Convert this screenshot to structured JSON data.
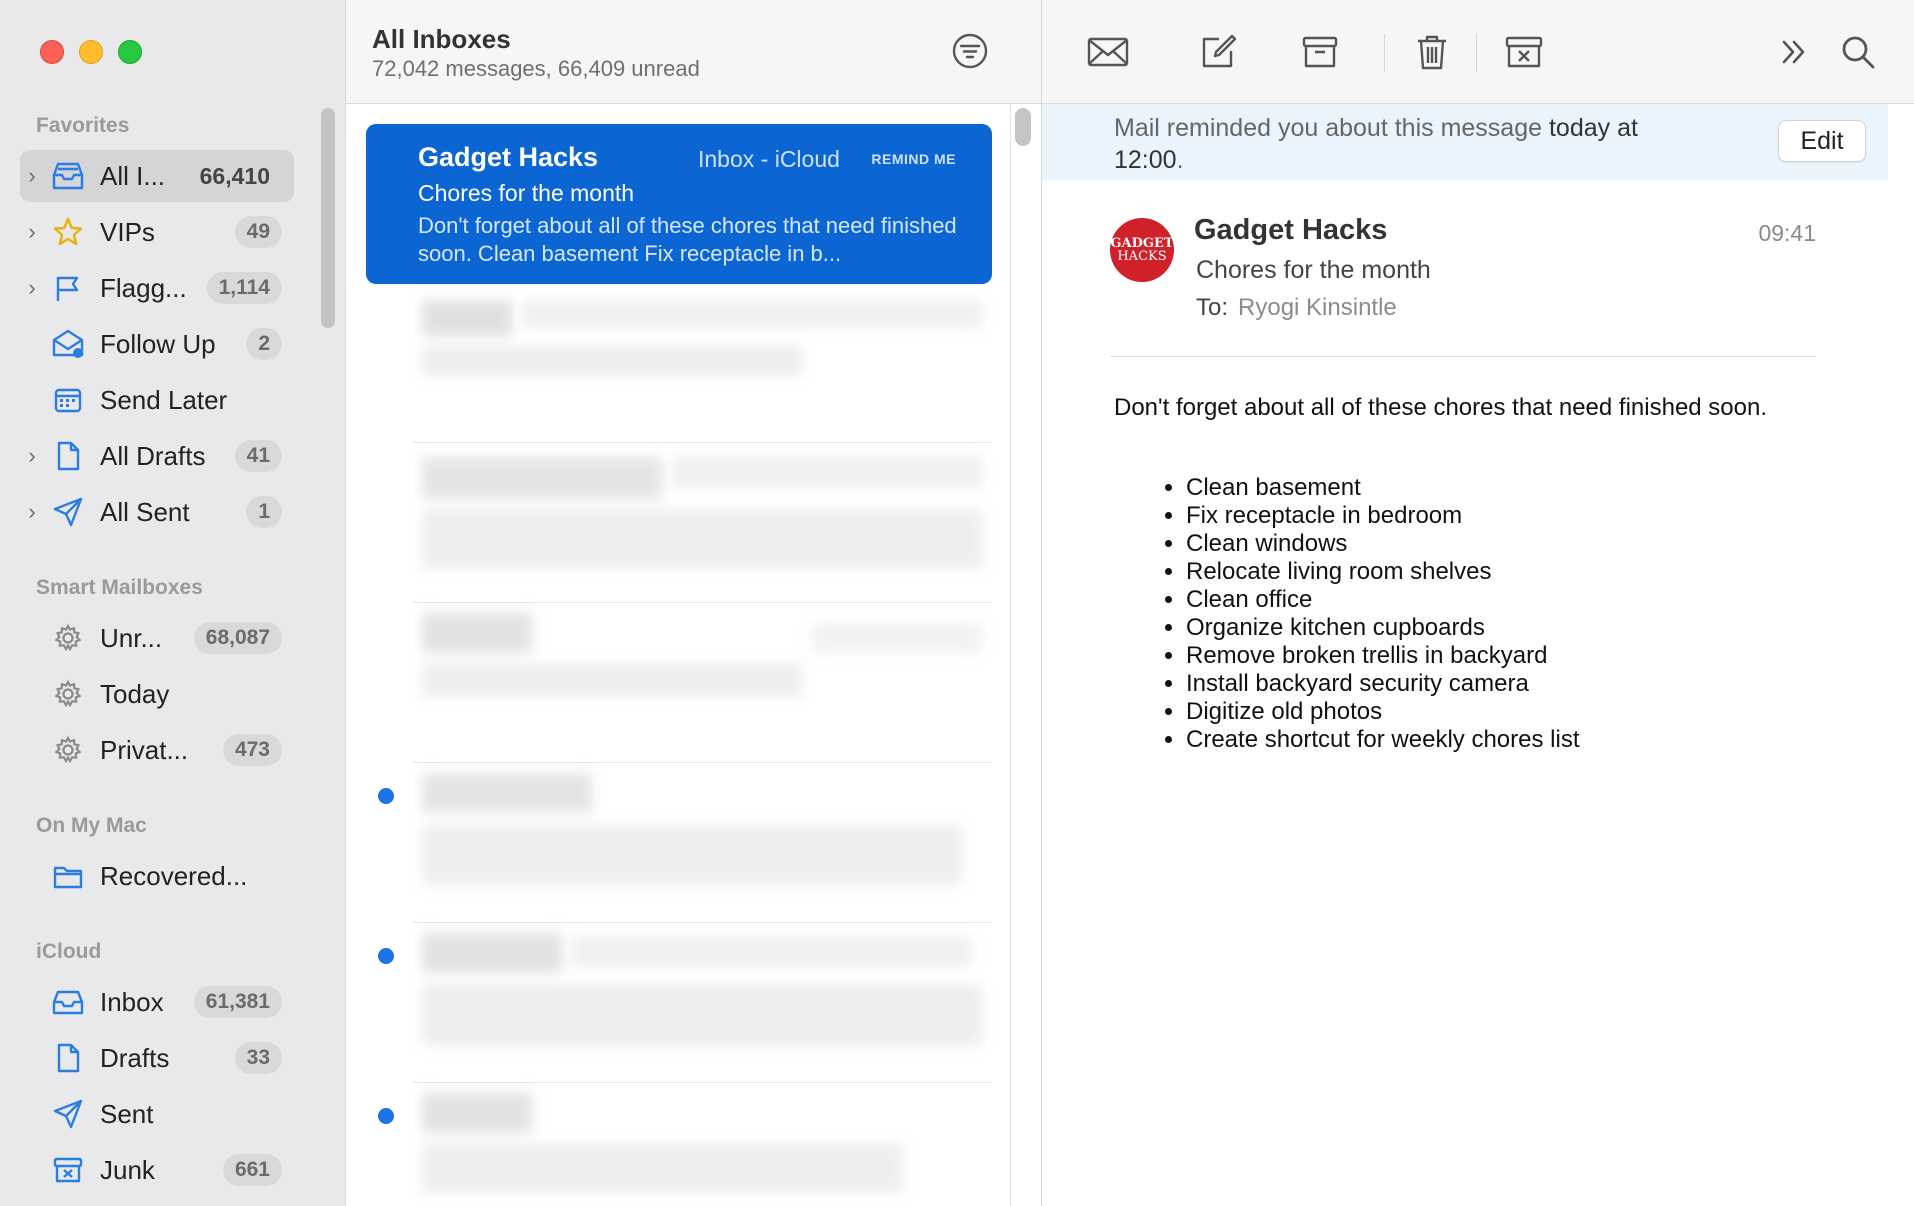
{
  "sidebar": {
    "favorites_title": "Favorites",
    "smart_title": "Smart Mailboxes",
    "onmac_title": "On My Mac",
    "icloud_title": "iCloud",
    "favorites": [
      {
        "label": "All I...",
        "badge": "66,410",
        "icon": "inbox-stack-icon"
      },
      {
        "label": "VIPs",
        "badge": "49",
        "icon": "star-icon"
      },
      {
        "label": "Flagg...",
        "badge": "1,114",
        "icon": "flag-icon"
      },
      {
        "label": "Follow Up",
        "badge": "2",
        "icon": "follow-up-envelope-icon"
      },
      {
        "label": "Send Later",
        "badge": "",
        "icon": "calendar-icon"
      },
      {
        "label": "All Drafts",
        "badge": "41",
        "icon": "document-icon"
      },
      {
        "label": "All Sent",
        "badge": "1",
        "icon": "paper-plane-icon"
      }
    ],
    "smart": [
      {
        "label": "Unr...",
        "badge": "68,087",
        "icon": "gear-icon"
      },
      {
        "label": "Today",
        "badge": "",
        "icon": "gear-icon"
      },
      {
        "label": "Privat...",
        "badge": "473",
        "icon": "gear-icon"
      }
    ],
    "onmac": [
      {
        "label": "Recovered...",
        "badge": "",
        "icon": "folder-icon"
      }
    ],
    "icloud": [
      {
        "label": "Inbox",
        "badge": "61,381",
        "icon": "inbox-tray-icon"
      },
      {
        "label": "Drafts",
        "badge": "33",
        "icon": "document-icon"
      },
      {
        "label": "Sent",
        "badge": "",
        "icon": "paper-plane-icon"
      },
      {
        "label": "Junk",
        "badge": "661",
        "icon": "junk-box-icon"
      }
    ]
  },
  "list": {
    "title": "All Inboxes",
    "subtitle": "72,042 messages, 66,409 unread",
    "selected": {
      "from": "Gadget Hacks",
      "mailbox": "Inbox - iCloud",
      "remind": "REMIND ME",
      "subject": "Chores for the month",
      "preview": "Don't forget about all of these chores that need finished soon. Clean basement Fix receptacle in b..."
    }
  },
  "reader": {
    "banner_prefix": "Mail reminded you about this message",
    "banner_emph": "today at 12:00",
    "banner_suffix": ".",
    "edit_label": "Edit",
    "avatar_line1": "GADGET",
    "avatar_line2": "HACKS",
    "sender": "Gadget Hacks",
    "time": "09:41",
    "subject": "Chores for the month",
    "to_label": "To:",
    "to_name": "Ryogi Kinsintle",
    "intro": "Don't forget about all of these chores that need finished soon.",
    "chores": [
      "Clean basement",
      "Fix receptacle in bedroom",
      "Clean windows",
      "Relocate living room shelves",
      "Clean office",
      "Organize kitchen cupboards",
      "Remove broken trellis in backyard",
      "Install backyard security camera",
      "Digitize old photos",
      "Create shortcut for weekly chores list"
    ]
  },
  "colors": {
    "accent": "#0b66d4",
    "sidebar_bg": "#e9e8ea",
    "icon_blue": "#2a7de1",
    "unread_dot": "#1a73e8",
    "banner_bg": "#eaf4fd"
  }
}
